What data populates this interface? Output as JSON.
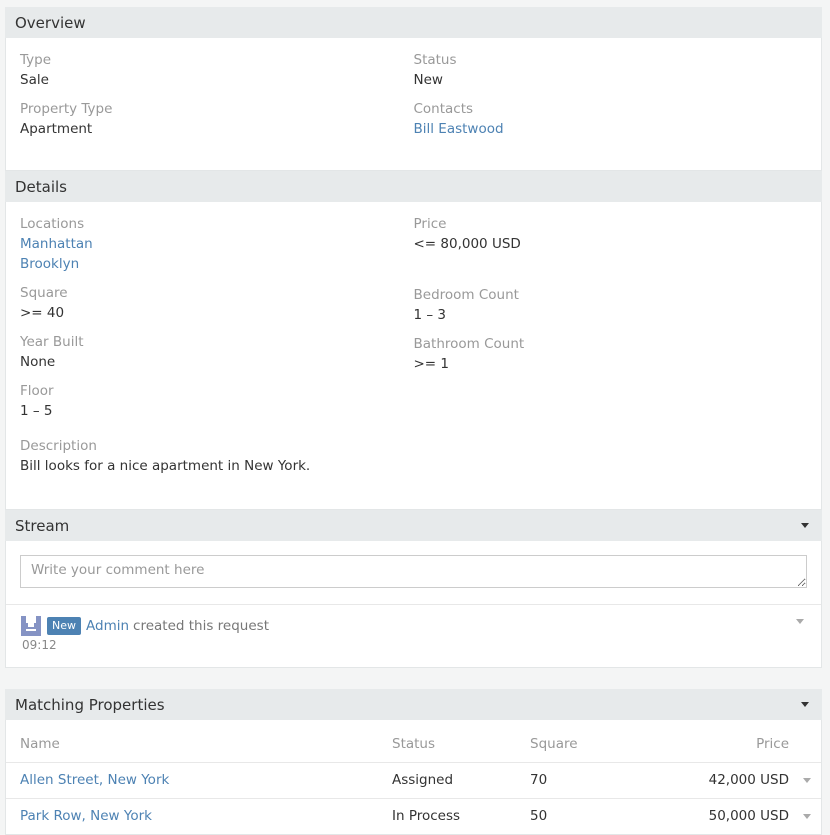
{
  "overview": {
    "title": "Overview",
    "left": [
      {
        "label": "Type",
        "value": "Sale"
      },
      {
        "label": "Property Type",
        "value": "Apartment"
      }
    ],
    "right": [
      {
        "label": "Status",
        "value": "New"
      },
      {
        "label": "Contacts",
        "value": "Bill Eastwood"
      }
    ]
  },
  "details": {
    "title": "Details",
    "locations_label": "Locations",
    "locations": [
      "Manhattan",
      "Brooklyn"
    ],
    "square_label": "Square",
    "square_value": ">= 40",
    "year_built_label": "Year Built",
    "year_built_value": "None",
    "floor_label": "Floor",
    "floor_value": "1 – 5",
    "description_label": "Description",
    "description_value": "Bill looks for a nice apartment in New York.",
    "price_label": "Price",
    "price_value": "<= 80,000 USD",
    "bedroom_label": "Bedroom Count",
    "bedroom_value": "1 – 3",
    "bathroom_label": "Bathroom Count",
    "bathroom_value": ">= 1"
  },
  "stream": {
    "title": "Stream",
    "comment_placeholder": "Write your comment here",
    "notes": [
      {
        "badge": "New",
        "user": "Admin",
        "text": "created this request",
        "time": "09:12"
      }
    ]
  },
  "matching": {
    "title": "Matching Properties",
    "columns": {
      "name": "Name",
      "status": "Status",
      "square": "Square",
      "price": "Price"
    },
    "rows": [
      {
        "name": "Allen Street, New York",
        "status": "Assigned",
        "square": "70",
        "price": "42,000 USD"
      },
      {
        "name": "Park Row, New York",
        "status": "In Process",
        "square": "50",
        "price": "50,000 USD"
      }
    ]
  },
  "colors": {
    "link": "#4d82b3",
    "badge": "#4d82b3",
    "panel_heading": "#e7eaeb",
    "avatar": "#8593c4"
  }
}
